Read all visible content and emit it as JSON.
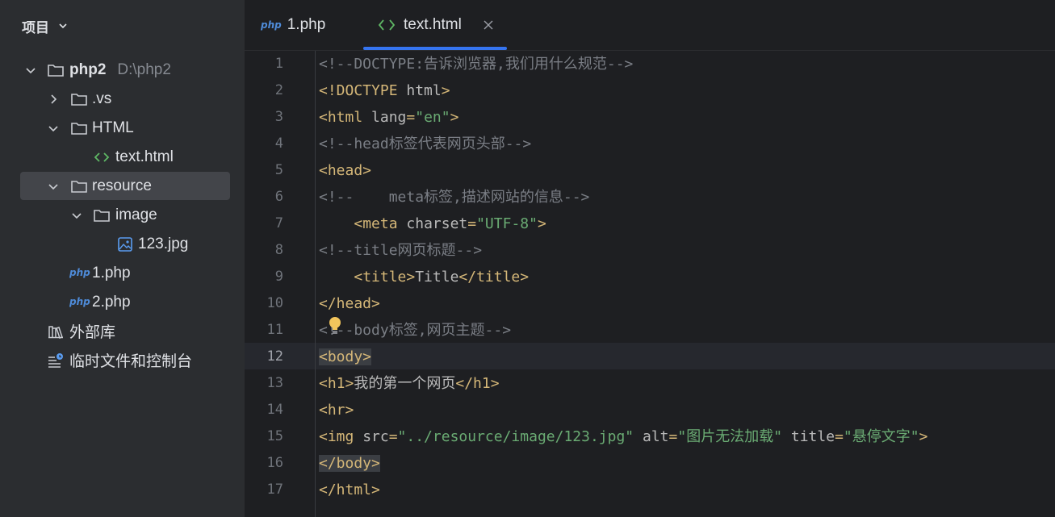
{
  "sidebar": {
    "title": "项目",
    "tree": [
      {
        "label": "php2",
        "hint": "D:\\php2"
      },
      {
        "label": ".vs"
      },
      {
        "label": "HTML"
      },
      {
        "label": "text.html"
      },
      {
        "label": "resource"
      },
      {
        "label": "image"
      },
      {
        "label": "123.jpg"
      },
      {
        "label": "1.php",
        "badge": "php"
      },
      {
        "label": "2.php",
        "badge": "php"
      },
      {
        "label": "外部库"
      },
      {
        "label": "临时文件和控制台"
      }
    ]
  },
  "tabs": [
    {
      "label": "1.php",
      "badge": "php",
      "active": false
    },
    {
      "label": "text.html",
      "active": true
    }
  ],
  "editor": {
    "current_line": 12,
    "lines": [
      {
        "n": "1",
        "parts": [
          [
            "c-com",
            "<!--DOCTYPE:告诉浏览器,我们用什么规范-->"
          ]
        ]
      },
      {
        "n": "2",
        "parts": [
          [
            "c-doc",
            "<!DOCTYPE "
          ],
          [
            "c-attr",
            "html"
          ],
          [
            "c-doc",
            ">"
          ]
        ]
      },
      {
        "n": "3",
        "parts": [
          [
            "c-tag",
            "<html "
          ],
          [
            "c-attr",
            "lang"
          ],
          [
            "c-tag",
            "="
          ],
          [
            "c-val",
            "\"en\""
          ],
          [
            "c-tag",
            ">"
          ]
        ]
      },
      {
        "n": "4",
        "parts": [
          [
            "c-com",
            "<!--head标签代表网页头部-->"
          ]
        ]
      },
      {
        "n": "5",
        "parts": [
          [
            "c-tag",
            "<head>"
          ]
        ]
      },
      {
        "n": "6",
        "parts": [
          [
            "c-com",
            "<!--    meta标签,描述网站的信息-->"
          ]
        ]
      },
      {
        "n": "7",
        "parts": [
          [
            "c-attr",
            "    "
          ],
          [
            "c-tag",
            "<meta "
          ],
          [
            "c-attr",
            "charset"
          ],
          [
            "c-tag",
            "="
          ],
          [
            "c-val",
            "\"UTF-8\""
          ],
          [
            "c-tag",
            ">"
          ]
        ]
      },
      {
        "n": "8",
        "parts": [
          [
            "c-com",
            "<!--title网页标题-->"
          ]
        ]
      },
      {
        "n": "9",
        "parts": [
          [
            "c-attr",
            "    "
          ],
          [
            "c-tag",
            "<title>"
          ],
          [
            "c-attr",
            "Title"
          ],
          [
            "c-tag",
            "</title>"
          ]
        ]
      },
      {
        "n": "10",
        "parts": [
          [
            "c-tag",
            "</head>"
          ]
        ]
      },
      {
        "n": "11",
        "parts": [
          [
            "c-com",
            "<!--body标签,网页主题-->"
          ]
        ]
      },
      {
        "n": "12",
        "parts": [
          [
            "c-tag hl",
            "<body>"
          ]
        ]
      },
      {
        "n": "13",
        "parts": [
          [
            "c-tag",
            "<h1>"
          ],
          [
            "c-attr",
            "我的第一个网页"
          ],
          [
            "c-tag",
            "</h1>"
          ]
        ]
      },
      {
        "n": "14",
        "parts": [
          [
            "c-tag",
            "<hr>"
          ]
        ]
      },
      {
        "n": "15",
        "parts": [
          [
            "c-tag",
            "<img "
          ],
          [
            "c-attr",
            "src"
          ],
          [
            "c-tag",
            "="
          ],
          [
            "c-val",
            "\"../resource/image/123.jpg\""
          ],
          [
            "c-attr",
            " alt"
          ],
          [
            "c-tag",
            "="
          ],
          [
            "c-val",
            "\"图片无法加载\""
          ],
          [
            "c-attr",
            " title"
          ],
          [
            "c-tag",
            "="
          ],
          [
            "c-val",
            "\"悬停文字\""
          ],
          [
            "c-tag",
            ">"
          ]
        ]
      },
      {
        "n": "16",
        "parts": [
          [
            "c-tag hl",
            "</body>"
          ]
        ]
      },
      {
        "n": "17",
        "parts": [
          [
            "c-tag",
            "</html>"
          ]
        ]
      }
    ]
  },
  "colors": {
    "accent": "#3574f0",
    "sidebar_bg": "#2b2d30",
    "editor_bg": "#1e1f22"
  }
}
